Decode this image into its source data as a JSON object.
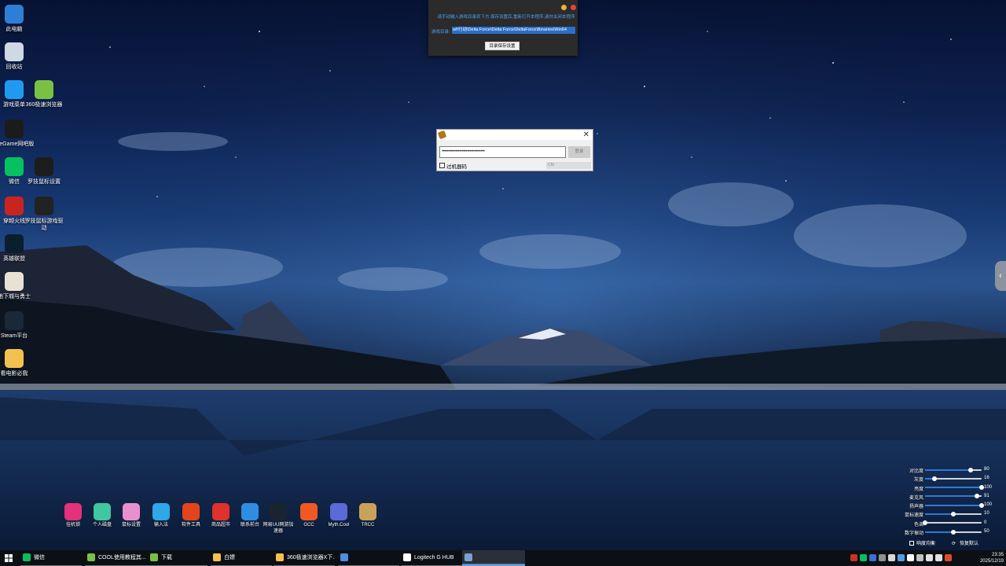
{
  "desktop_icons": [
    {
      "label": "此电脑",
      "icon": "monitor-icon",
      "color": "#2d7fd6"
    },
    {
      "label": "回收站",
      "icon": "recycle-bin-icon",
      "color": "#cfd8e3"
    },
    {
      "label": "游戏菜单",
      "icon": "cloud-menu-icon",
      "color": "#1e9bf0"
    },
    {
      "label": "360极速浏览器",
      "icon": "browser-360-icon",
      "color": "#7ac143"
    },
    {
      "label": "WeGame网吧版",
      "icon": "wegame-icon",
      "color": "#1b1b1b"
    },
    {
      "label": "微信",
      "icon": "wechat-icon",
      "color": "#07c160"
    },
    {
      "label": "罗技鼠标设置",
      "icon": "logitech-icon",
      "color": "#1d1d1d"
    },
    {
      "label": "穿越火线",
      "icon": "crossfire-icon",
      "color": "#c9241f"
    },
    {
      "label": "罗技鼠标游戏驱动",
      "icon": "logitech-g-icon",
      "color": "#222"
    },
    {
      "label": "英雄联盟",
      "icon": "league-icon",
      "color": "#0b1e2d"
    },
    {
      "label": "地下城与勇士",
      "icon": "dnf-icon",
      "color": "#e8e2d4"
    },
    {
      "label": "Steam平台",
      "icon": "steam-icon",
      "color": "#1b2838"
    },
    {
      "label": "看电影必我",
      "icon": "movie-icon",
      "color": "#f2c14e"
    }
  ],
  "top_popup": {
    "message": "请手动输入游戏目录到下方,保存设置后,重新打开本程序,请勿关闭本程序",
    "dir_label": "游戏目录:",
    "dir_value": "wf\\行动\\Delta Force\\Delta Force\\DeltaForce\\Binaries\\Win64",
    "save_button": "目录保存设置"
  },
  "login_dialog": {
    "password_mask": "••••••••••••••••••••••••••••••••••",
    "login_button": "登录",
    "checkbox_label": "过机器码",
    "bar_text": "CM"
  },
  "apps": [
    {
      "label": "挂机锁",
      "icon": "lock-icon",
      "color": "#e4317a"
    },
    {
      "label": "个人磁盘",
      "icon": "disk-icon",
      "color": "#3fc7a0"
    },
    {
      "label": "鼠标设置",
      "icon": "mouse-icon",
      "color": "#e98fd0"
    },
    {
      "label": "输入法",
      "icon": "keyboard-icon",
      "color": "#2fa7e8"
    },
    {
      "label": "软件工具",
      "icon": "office-icon",
      "color": "#e4441c"
    },
    {
      "label": "商品超市",
      "icon": "cart-icon",
      "color": "#e0322c"
    },
    {
      "label": "联系前台",
      "icon": "contact-icon",
      "color": "#2f8de4"
    },
    {
      "label": "网易UU网游加速器",
      "icon": "uu-icon",
      "color": "#1a2430"
    },
    {
      "label": "GCC",
      "icon": "gcc-icon",
      "color": "#f05a22"
    },
    {
      "label": "Myth.Cool",
      "icon": "myth-icon",
      "color": "#5a6ad8"
    },
    {
      "label": "TRCC",
      "icon": "trcc-icon",
      "color": "#c9a25a"
    }
  ],
  "sliders": [
    {
      "label": "对比度",
      "value": "80",
      "level": 0.8
    },
    {
      "label": "灰度",
      "value": "16",
      "level": 0.16
    },
    {
      "label": "亮度",
      "value": "100",
      "level": 1.0
    },
    {
      "label": "麦克风",
      "value": "91",
      "level": 0.91
    },
    {
      "label": "扬声器",
      "value": "100",
      "level": 1.0
    },
    {
      "label": "鼠标速度",
      "value": "10",
      "level": 0.5
    },
    {
      "label": "色调",
      "value": "0",
      "level": 0.0
    },
    {
      "label": "数字振动",
      "value": "50",
      "level": 0.5
    }
  ],
  "slider_footer": {
    "checkbox_label": "响度均衡",
    "restore_label": "恢复默认"
  },
  "taskbar": {
    "items": [
      {
        "label": "微信",
        "icon": "wechat-icon",
        "color": "#07c160"
      },
      {
        "label": "COOL使用教程其...",
        "icon": "browser-360-icon",
        "color": "#7ac143"
      },
      {
        "label": "下载",
        "icon": "browser-360-icon",
        "color": "#7ac143"
      },
      {
        "label": "白嫖",
        "icon": "folder-icon",
        "color": "#f2c14e"
      },
      {
        "label": "360极速浏览器X下...",
        "icon": "folder-icon",
        "color": "#f2c14e"
      },
      {
        "label": "",
        "icon": "window-icon",
        "color": "#4a8fe0"
      },
      {
        "label": "Logitech G HUB",
        "icon": "logitech-g-icon",
        "color": "#ffffff"
      },
      {
        "label": "",
        "icon": "app-icon",
        "color": "#7aa0d0"
      }
    ],
    "time": "23:35",
    "date": "2025/12/19"
  },
  "side_handle": "‹"
}
